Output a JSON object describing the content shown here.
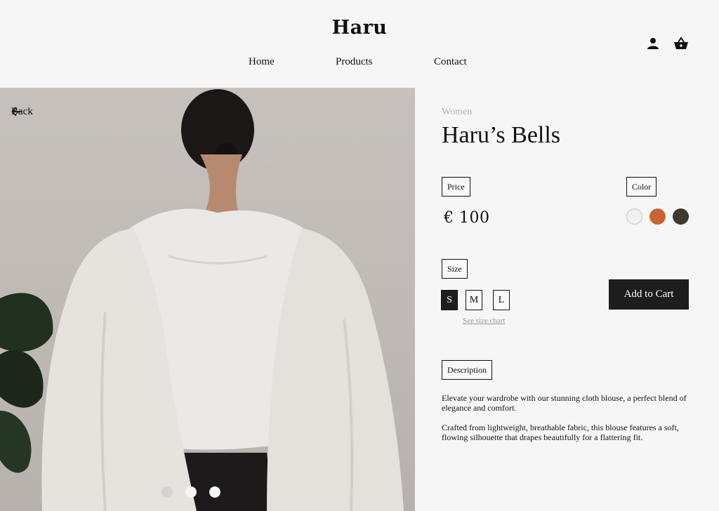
{
  "header": {
    "brand": "Haru",
    "nav": [
      "Home",
      "Products",
      "Contact"
    ],
    "icons": [
      "user-icon",
      "basket-icon"
    ]
  },
  "hero": {
    "back_label": "Back",
    "carousel": {
      "count": 3,
      "active": 1
    }
  },
  "product": {
    "category": "Women",
    "name": "Haru’s Bells",
    "price_label": "Price",
    "price": "€ 100",
    "color_label": "Color",
    "colors": [
      "#f0f0f0",
      "#c8642e",
      "#3e3831"
    ],
    "size_label": "Size",
    "sizes": [
      "S",
      "M",
      "L"
    ],
    "selected_size": "S",
    "size_chart_link": "See size chart",
    "add_to_cart": "Add to Cart",
    "description_label": "Description",
    "description": [
      "Elevate your wardrobe with our stunning cloth blouse, a perfect blend of elegance and comfort.",
      "Crafted from lightweight, breathable fabric, this blouse features a soft, flowing silhouette that drapes beautifully for a flattering fit."
    ]
  }
}
